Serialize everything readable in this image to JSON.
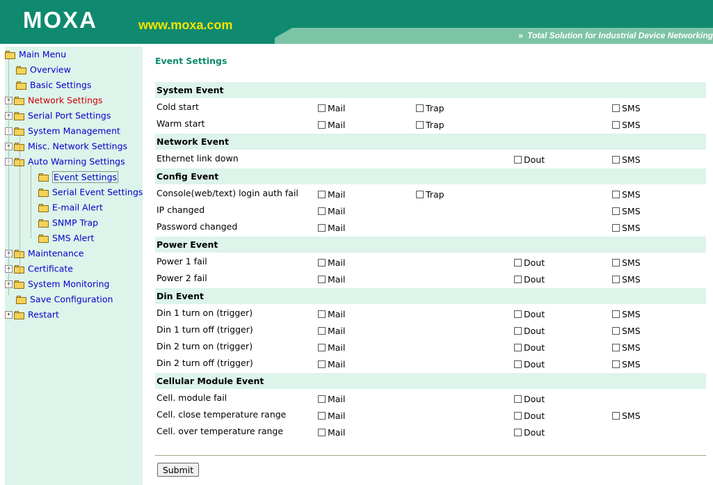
{
  "header": {
    "logo": "MOXA",
    "url": "www.moxa.com",
    "tagline": "Total Solution for Industrial Device Networking",
    "tagline_arrow": "»"
  },
  "colors": {
    "brand_green": "#0f8a6e",
    "band_light": "#7cc4a6",
    "sidebar_bg": "#ddf4ea",
    "section_bg": "#ddf4ea",
    "url_yellow": "#f6e400",
    "link_blue": "#0000cc",
    "link_red": "#cc0000"
  },
  "menu": {
    "items": [
      {
        "label": "Main Menu",
        "icon": "folder-open-icon"
      },
      {
        "label": "Overview",
        "icon": "folder-icon"
      },
      {
        "label": "Basic Settings",
        "icon": "folder-icon"
      },
      {
        "label": "Network Settings",
        "icon": "folder-icon",
        "expander": "+"
      },
      {
        "label": "Serial Port Settings",
        "icon": "folder-icon",
        "expander": "+"
      },
      {
        "label": "System Management",
        "icon": "folder-open-icon",
        "expander": "-"
      },
      {
        "label": "Misc. Network Settings",
        "icon": "folder-icon",
        "expander": "+"
      },
      {
        "label": "Auto Warning Settings",
        "icon": "folder-open-icon",
        "expander": "-"
      },
      {
        "label": "Event Settings",
        "icon": "folder-icon",
        "selected": true
      },
      {
        "label": "Serial Event Settings",
        "icon": "folder-icon"
      },
      {
        "label": "E-mail Alert",
        "icon": "folder-icon"
      },
      {
        "label": "SNMP Trap",
        "icon": "folder-icon"
      },
      {
        "label": "SMS Alert",
        "icon": "folder-icon"
      },
      {
        "label": "Maintenance",
        "icon": "folder-icon",
        "expander": "+"
      },
      {
        "label": "Certificate",
        "icon": "folder-icon",
        "expander": "+"
      },
      {
        "label": "System Monitoring",
        "icon": "folder-icon",
        "expander": "+"
      },
      {
        "label": "Save Configuration",
        "icon": "folder-icon"
      },
      {
        "label": "Restart",
        "icon": "folder-icon",
        "expander": "+"
      }
    ]
  },
  "page": {
    "title": "Event Settings",
    "option_labels": {
      "mail": "Mail",
      "trap": "Trap",
      "dout": "Dout",
      "sms": "SMS"
    },
    "sections": [
      {
        "title": "System Event",
        "rows": [
          {
            "name": "Cold start",
            "options": [
              "mail",
              "trap",
              "sms"
            ]
          },
          {
            "name": "Warm start",
            "options": [
              "mail",
              "trap",
              "sms"
            ]
          }
        ]
      },
      {
        "title": "Network Event",
        "rows": [
          {
            "name": "Ethernet link down",
            "options": [
              "dout",
              "sms"
            ]
          }
        ]
      },
      {
        "title": "Config Event",
        "rows": [
          {
            "name": "Console(web/text) login auth fail",
            "options": [
              "mail",
              "trap",
              "sms"
            ]
          },
          {
            "name": "IP changed",
            "options": [
              "mail",
              "sms"
            ]
          },
          {
            "name": "Password changed",
            "options": [
              "mail",
              "sms"
            ]
          }
        ]
      },
      {
        "title": "Power Event",
        "rows": [
          {
            "name": "Power 1 fail",
            "options": [
              "mail",
              "dout",
              "sms"
            ]
          },
          {
            "name": "Power 2 fail",
            "options": [
              "mail",
              "dout",
              "sms"
            ]
          }
        ]
      },
      {
        "title": "Din Event",
        "rows": [
          {
            "name": "Din 1 turn on (trigger)",
            "options": [
              "mail",
              "dout",
              "sms"
            ]
          },
          {
            "name": "Din 1 turn off (trigger)",
            "options": [
              "mail",
              "dout",
              "sms"
            ]
          },
          {
            "name": "Din 2 turn on (trigger)",
            "options": [
              "mail",
              "dout",
              "sms"
            ]
          },
          {
            "name": "Din 2 turn off (trigger)",
            "options": [
              "mail",
              "dout",
              "sms"
            ]
          }
        ]
      },
      {
        "title": "Cellular Module Event",
        "rows": [
          {
            "name": "Cell. module fail",
            "options": [
              "mail",
              "dout"
            ]
          },
          {
            "name": "Cell. close temperature range",
            "options": [
              "mail",
              "dout",
              "sms"
            ]
          },
          {
            "name": "Cell. over temperature range",
            "options": [
              "mail",
              "dout"
            ]
          }
        ]
      }
    ],
    "submit_label": "Submit"
  }
}
